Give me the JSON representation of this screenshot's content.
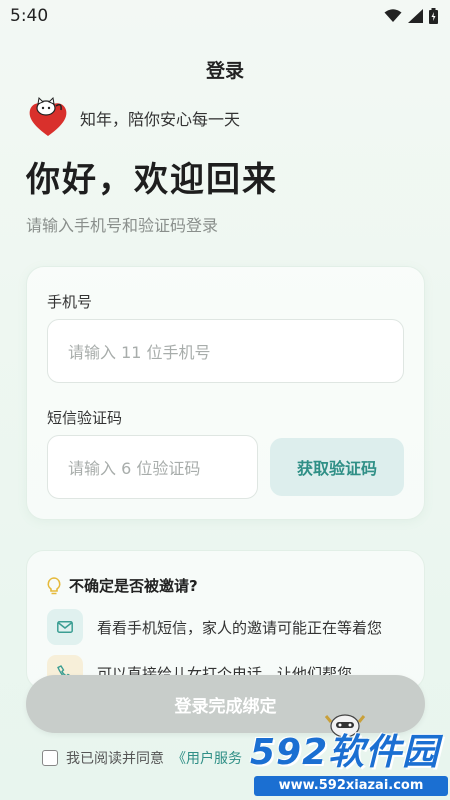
{
  "status_bar": {
    "time": "5:40"
  },
  "header": {
    "title": "登录"
  },
  "brand": {
    "slogan": "知年，陪你安心每一天"
  },
  "greeting": {
    "title": "你好，欢迎回来",
    "subtitle": "请输入手机号和验证码登录"
  },
  "form": {
    "phone_label": "手机号",
    "phone_placeholder": "请输入 11 位手机号",
    "code_label": "短信验证码",
    "code_placeholder": "请输入 6 位验证码",
    "get_code_label": "获取验证码"
  },
  "tips": {
    "title": "不确定是否被邀请?",
    "items": [
      {
        "icon": "mail-icon",
        "text": "看看手机短信，家人的邀请可能正在等着您"
      },
      {
        "icon": "phone-icon",
        "text": "可以直接给儿女打个电话，让他们帮您"
      }
    ]
  },
  "actions": {
    "login_label": "登录完成绑定"
  },
  "agreement": {
    "prefix": "我已阅读并同意",
    "link": "《用户服务"
  },
  "watermark": {
    "main": "592软件园",
    "url": "www.592xiazai.com"
  },
  "colors": {
    "accent": "#2f8f86",
    "button_disabled": "#c8cdca",
    "brand_red": "#d9302c"
  }
}
